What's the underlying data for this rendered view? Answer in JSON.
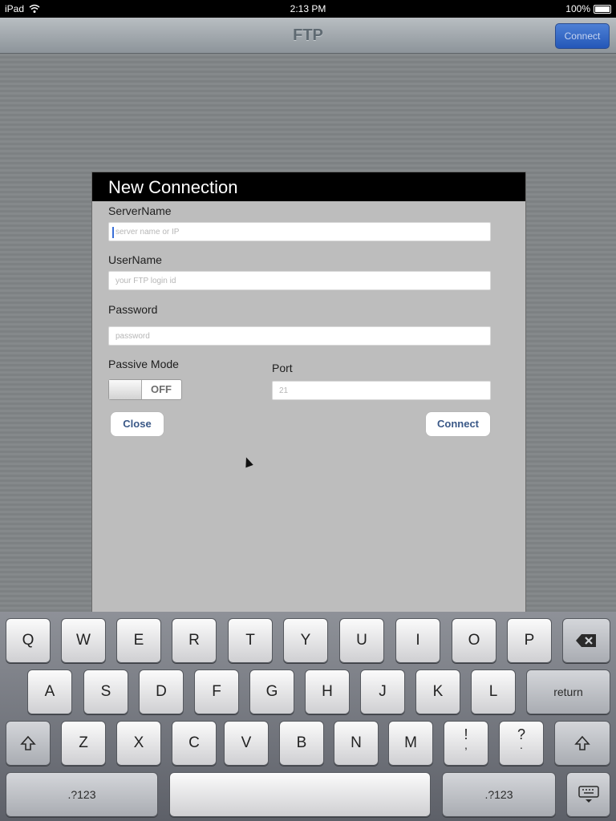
{
  "status_bar": {
    "carrier": "iPad",
    "wifi_icon": "wifi-icon",
    "time": "2:13 PM",
    "battery": "100%"
  },
  "nav_bar": {
    "title": "FTP",
    "connect_label": "Connect"
  },
  "dialog": {
    "title": "New Connection",
    "server": {
      "label": "ServerName",
      "placeholder": "server name or IP"
    },
    "user": {
      "label": "UserName",
      "placeholder": "your FTP login id"
    },
    "password": {
      "label": "Password",
      "placeholder": "password"
    },
    "passive": {
      "label": "Passive Mode",
      "state": "OFF"
    },
    "port": {
      "label": "Port",
      "placeholder": "21"
    },
    "close_label": "Close",
    "connect_label": "Connect"
  },
  "keyboard": {
    "row1": [
      "Q",
      "W",
      "E",
      "R",
      "T",
      "Y",
      "U",
      "I",
      "O",
      "P"
    ],
    "row2": [
      "A",
      "S",
      "D",
      "F",
      "G",
      "H",
      "J",
      "K",
      "L"
    ],
    "row3": [
      "Z",
      "X",
      "C",
      "V",
      "B",
      "N",
      "M"
    ],
    "return_label": "return",
    "numbers_label": ".?123",
    "exclaim": "!",
    "comma": ",",
    "question": "?",
    "period": ".",
    "icons": [
      "backspace-icon",
      "shift-icon",
      "keyboard-dismiss-icon"
    ]
  }
}
